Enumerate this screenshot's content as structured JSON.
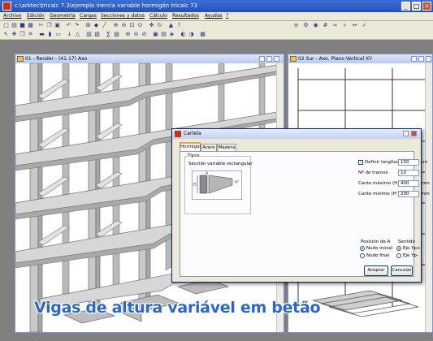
{
  "window": {
    "title": "c:\\arktec\\tricalc 7.3\\ejemplo inercia variable hormigón tricalc 73",
    "controls": [
      "minimize",
      "maximize",
      "close"
    ]
  },
  "menu": [
    "Archivo",
    "Edición",
    "Geometría",
    "Cargas",
    "Secciones y datos",
    "Cálculo",
    "Resultados",
    "Ayudas",
    "?"
  ],
  "toolbar_icons": [
    "new-icon",
    "open-icon",
    "save-icon",
    "print-icon",
    "cut-icon",
    "copy-icon",
    "paste-icon",
    "undo-icon",
    "redo-icon",
    "grid-icon",
    "node-icon",
    "bar-icon",
    "zoom-in-icon",
    "zoom-out-icon",
    "zoom-window-icon",
    "zoom-all-icon",
    "pan-icon",
    "rotate-icon",
    "render-icon",
    "help-icon"
  ],
  "windows": {
    "render": {
      "title": "01 - Render - (41-17) Axo"
    },
    "elevation": {
      "title": "02 Sur - Axo. Plano Vertical XY"
    }
  },
  "dialog": {
    "title": "Cartela",
    "tabs": [
      "Hormigón",
      "Acero",
      "Madera"
    ],
    "active_tab": "Hormigón",
    "group_tipos": "Tipos",
    "section_label": "Sección variable rectangular",
    "define_length": {
      "label": "Definir longitud",
      "checked": true,
      "value": "150",
      "unit": "cm"
    },
    "segments": {
      "label": "Nº de tramos",
      "value": "10"
    },
    "max_edge": {
      "label": "Canto máximo (H)",
      "value": "400",
      "unit": "mm"
    },
    "min_edge": {
      "label": "Canto mínimo (H')",
      "value": "200",
      "unit": "mm"
    },
    "position": {
      "label": "Posición de A",
      "options": [
        "Nudo inicial",
        "Nudo final"
      ],
      "selected": "Nudo inicial"
    },
    "direction": {
      "label": "Sentido",
      "options": [
        "Eje Yp+",
        "Eje Yp-"
      ],
      "selected": "Eje Yp+"
    },
    "accept": "Aceptar",
    "cancel": "Cancelar"
  },
  "caption": "Vigas de altura variável em betão",
  "colors": {
    "caption": "#2a67c7",
    "titlebar": "#2150b8",
    "accent_tab": "#f0a43a"
  }
}
